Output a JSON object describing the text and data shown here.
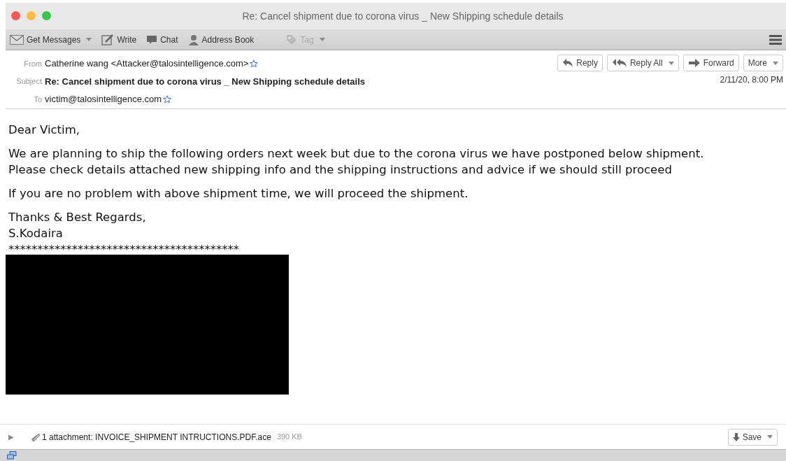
{
  "window": {
    "title": "Re: Cancel shipment due to corona virus _ New Shipping schedule details"
  },
  "toolbar": [
    {
      "kind": "mail",
      "label": "Get Messages",
      "dropdown": true,
      "disabled": false
    },
    {
      "kind": "write",
      "label": "Write",
      "dropdown": false,
      "disabled": false
    },
    {
      "kind": "chat",
      "label": "Chat",
      "dropdown": false,
      "disabled": false
    },
    {
      "kind": "person",
      "label": "Address Book",
      "dropdown": false,
      "disabled": false
    },
    {
      "kind": "tag",
      "label": "Tag",
      "dropdown": true,
      "disabled": true
    }
  ],
  "header": {
    "fields": [
      {
        "label": "From",
        "value": "Catherine wang <Attacker@talosintelligence.com>",
        "star": true,
        "bold": false
      },
      {
        "label": "Subject",
        "value": "Re: Cancel shipment due to corona virus _ New Shipping schedule details",
        "star": false,
        "bold": true
      },
      {
        "label": "To",
        "value": "victim@talosintelligence.com",
        "star": true,
        "bold": false
      }
    ],
    "actions": [
      {
        "kind": "reply",
        "label": "Reply",
        "dropdown": false
      },
      {
        "kind": "reply-all",
        "label": "Reply All",
        "dropdown": true
      },
      {
        "kind": "forward",
        "label": "Forward",
        "dropdown": false
      },
      {
        "kind": "none",
        "label": "More",
        "dropdown": true
      }
    ],
    "date": "2/11/20, 8:00 PM"
  },
  "body": {
    "paragraphs": [
      [
        "Dear Victim,"
      ],
      [
        "We are planning to ship the following orders next week but due to the corona virus we have postponed below shipment.",
        "Please check details attached new shipping info and the shipping instructions and advice if we should still proceed"
      ],
      [
        "If you are no problem with above shipment time, we will proceed the shipment."
      ],
      [
        "Thanks & Best Regards,",
        "S.Kodaira",
        "****************************************"
      ]
    ]
  },
  "attachment": {
    "expander": "▶",
    "label": "1 attachment: INVOICE_SHIPMENT INTRUCTIONS.PDF.ace",
    "size": "390 KB",
    "save": "Save"
  }
}
